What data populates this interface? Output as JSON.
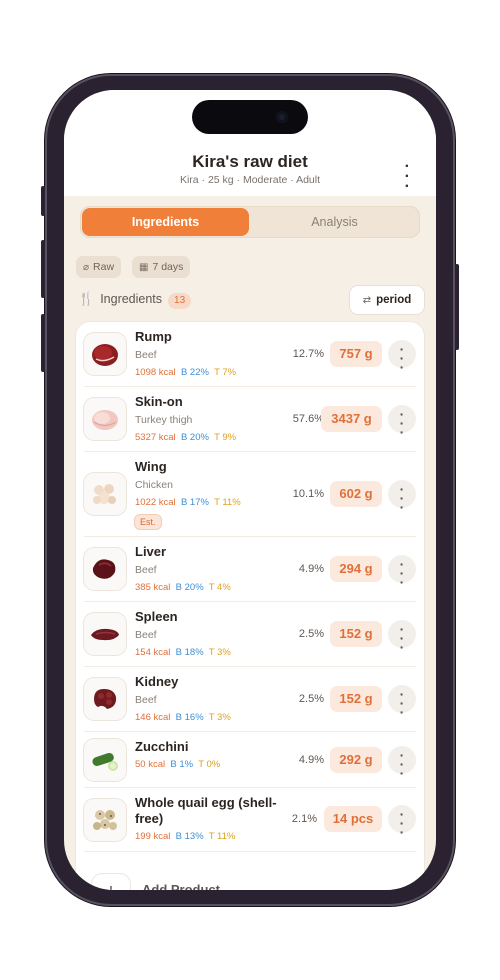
{
  "header": {
    "title": "Kira's raw diet",
    "subtitle": "Kira · 25 kg · Moderate · Adult",
    "menu_icon": "more-vertical-icon"
  },
  "tabs": [
    {
      "label": "Ingredients",
      "active": true
    },
    {
      "label": "Analysis",
      "active": false
    }
  ],
  "chips": [
    {
      "label": "Raw",
      "icon": "leaf-icon"
    },
    {
      "label": "7 days",
      "icon": "calendar-icon"
    }
  ],
  "ingredients_header": {
    "label": "Ingredients",
    "count": "13",
    "period_label": "period"
  },
  "items": [
    {
      "name": "Rump",
      "type": "Beef",
      "kcal": "1098 kcal",
      "b": "B 22%",
      "t": "T 7%",
      "pct": "12.7%",
      "amount": "757 g",
      "image": "beef-steak-icon"
    },
    {
      "name": "Skin-on",
      "type": "Turkey thigh",
      "kcal": "5327 kcal",
      "b": "B 20%",
      "t": "T 9%",
      "pct": "57.6%",
      "amount": "3437 g",
      "image": "turkey-thigh-icon"
    },
    {
      "name": "Wing",
      "type": "Chicken",
      "kcal": "1022 kcal",
      "b": "B 17%",
      "t": "T 11%",
      "pct": "10.1%",
      "amount": "602 g",
      "image": "chicken-wing-icon",
      "badge": "Est."
    },
    {
      "name": "Liver",
      "type": "Beef",
      "kcal": "385 kcal",
      "b": "B 20%",
      "t": "T 4%",
      "pct": "4.9%",
      "amount": "294 g",
      "image": "liver-icon"
    },
    {
      "name": "Spleen",
      "type": "Beef",
      "kcal": "154 kcal",
      "b": "B 18%",
      "t": "T 3%",
      "pct": "2.5%",
      "amount": "152 g",
      "image": "spleen-icon"
    },
    {
      "name": "Kidney",
      "type": "Beef",
      "kcal": "146 kcal",
      "b": "B 16%",
      "t": "T 3%",
      "pct": "2.5%",
      "amount": "152 g",
      "image": "kidney-icon"
    },
    {
      "name": "Zucchini",
      "type": "",
      "kcal": "50 kcal",
      "b": "B 1%",
      "t": "T 0%",
      "pct": "4.9%",
      "amount": "292 g",
      "image": "zucchini-icon"
    },
    {
      "name": "Whole quail egg (shell-free)",
      "type": "",
      "kcal": "199 kcal",
      "b": "B 13%",
      "t": "T 11%",
      "pct": "2.1%",
      "amount": "14 pcs",
      "image": "quail-egg-icon"
    }
  ],
  "add_product": {
    "label": "Add Product"
  },
  "colors": {
    "accent": "#ef7f39",
    "background": "#f6efe6",
    "protein": "#3d8fd6",
    "fat": "#e0a11d"
  }
}
